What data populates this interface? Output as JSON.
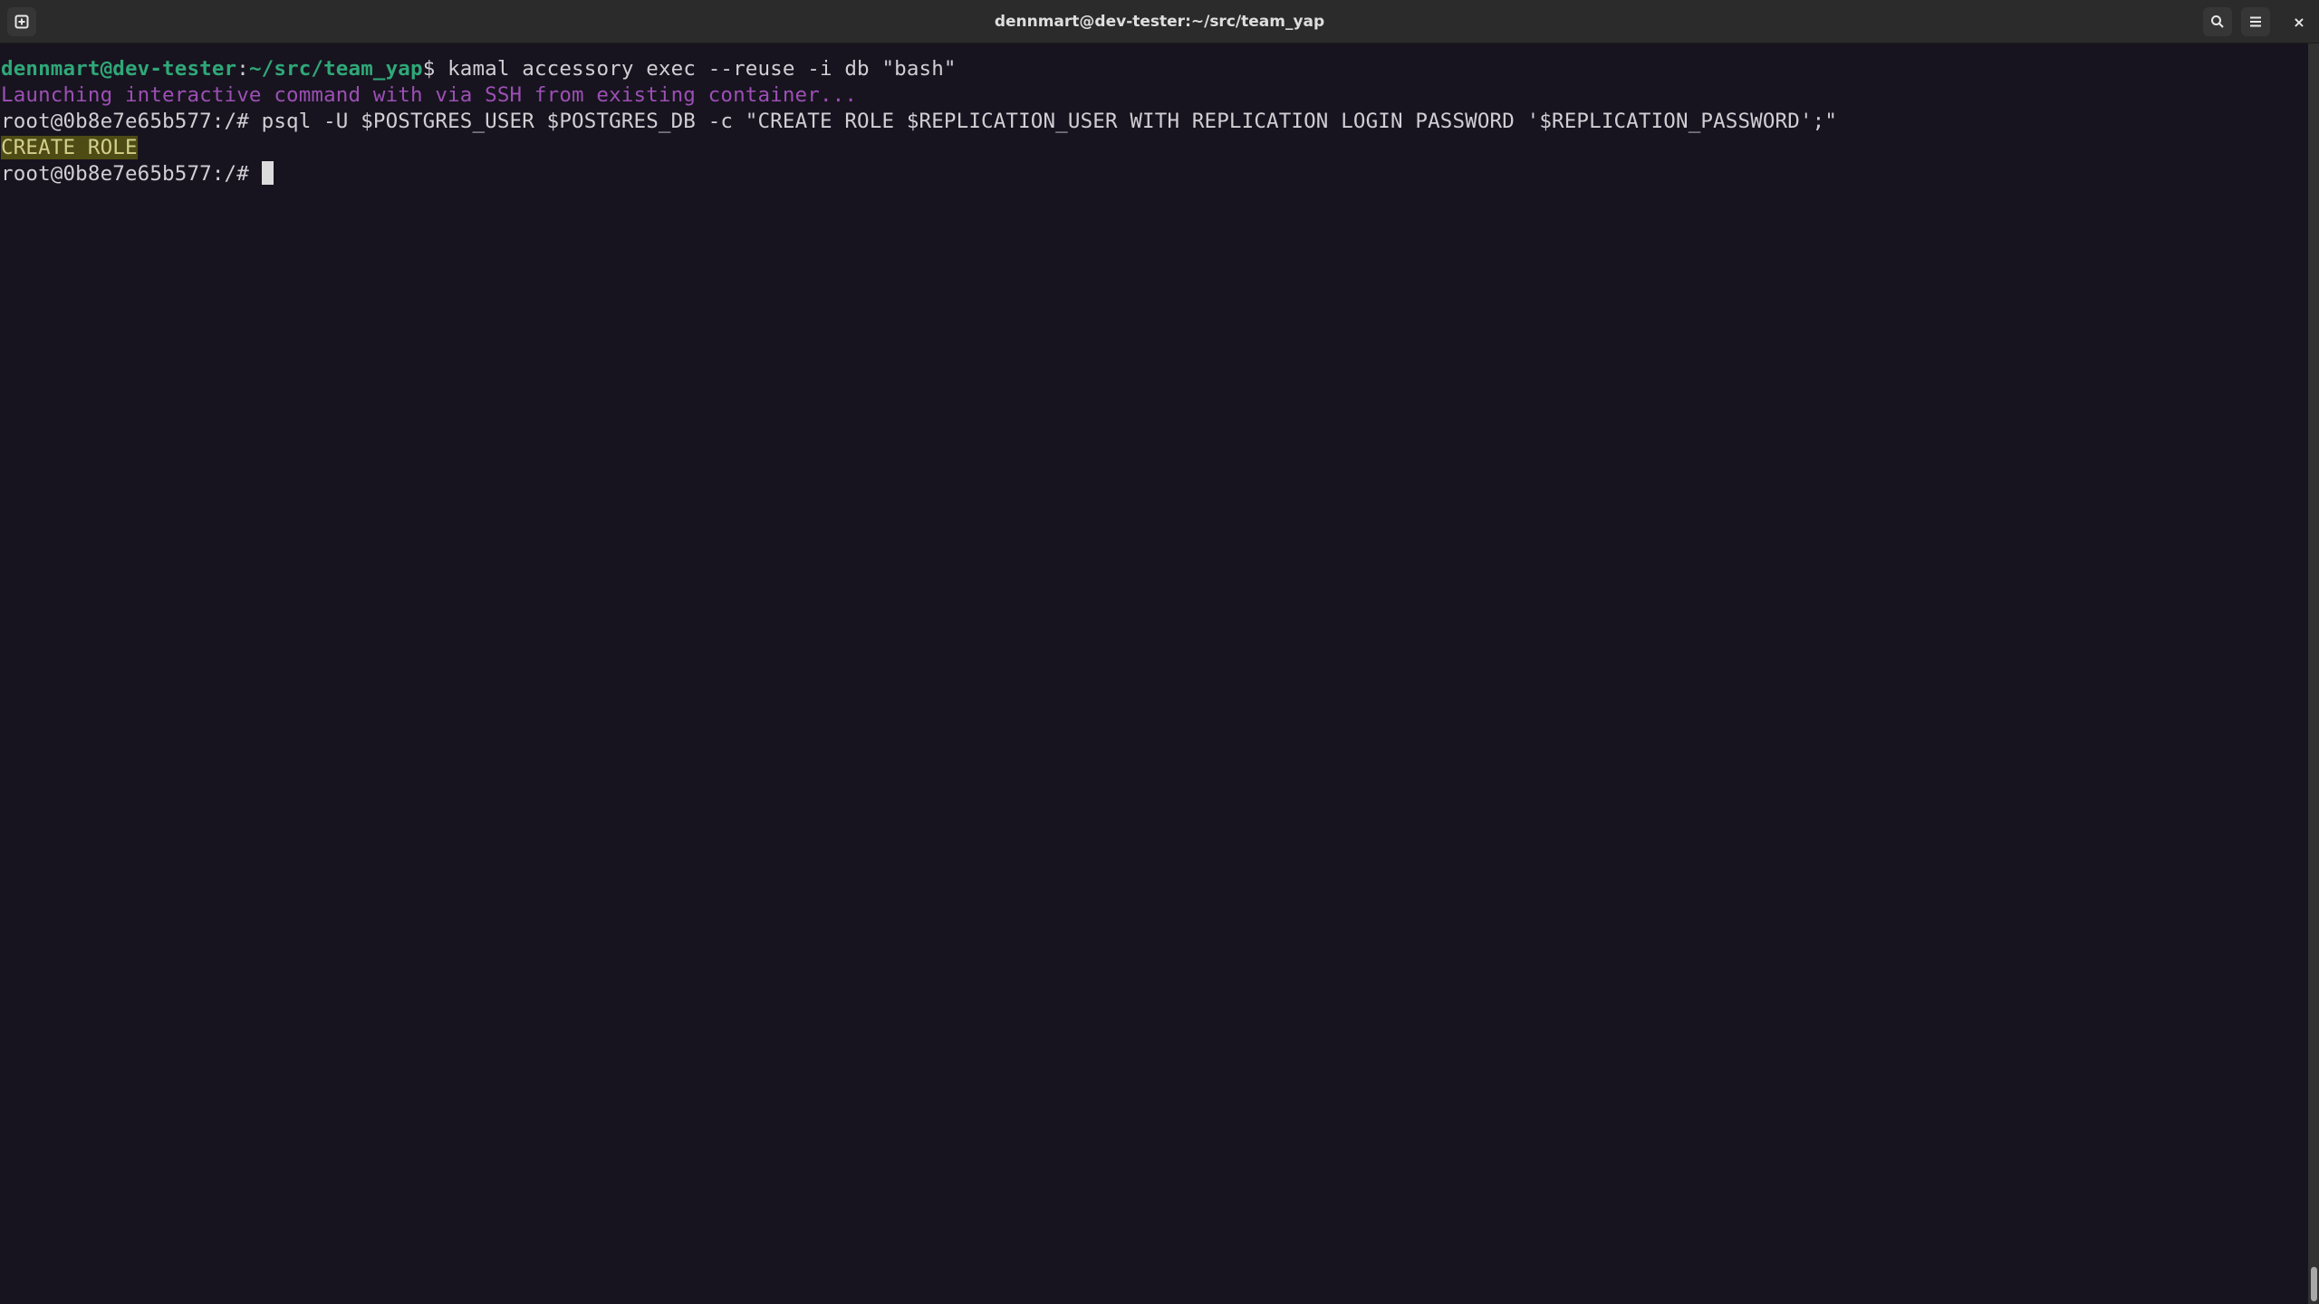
{
  "window": {
    "title": "dennmart@dev-tester:~/src/team_yap",
    "buttons": {
      "new_tab_icon": "new-tab-icon",
      "search_icon": "search-icon",
      "menu_icon": "hamburger-menu-icon",
      "close_label": "×"
    }
  },
  "terminal": {
    "colors": {
      "background": "#17141f",
      "prompt_green": "#2fa878",
      "info_purple": "#9c4fb4",
      "highlight_bg": "#4e4b14",
      "highlight_fg": "#d4cf8c",
      "foreground": "#d0cfd4"
    },
    "lines": [
      {
        "prompt_user_host": "dennmart@dev-tester",
        "prompt_sep": ":",
        "prompt_path": "~/src/team_yap",
        "prompt_symbol": "$",
        "command": " kamal accessory exec --reuse -i db \"bash\""
      },
      {
        "text": "Launching interactive command with via SSH from existing container..."
      },
      {
        "prompt": "root@0b8e7e65b577:/#",
        "command": " psql -U $POSTGRES_USER $POSTGRES_DB -c \"CREATE ROLE $REPLICATION_USER WITH REPLICATION LOGIN PASSWORD '$REPLICATION_PASSWORD';\""
      },
      {
        "text": "CREATE ROLE"
      },
      {
        "prompt": "root@0b8e7e65b577:/#",
        "command": " "
      }
    ]
  }
}
